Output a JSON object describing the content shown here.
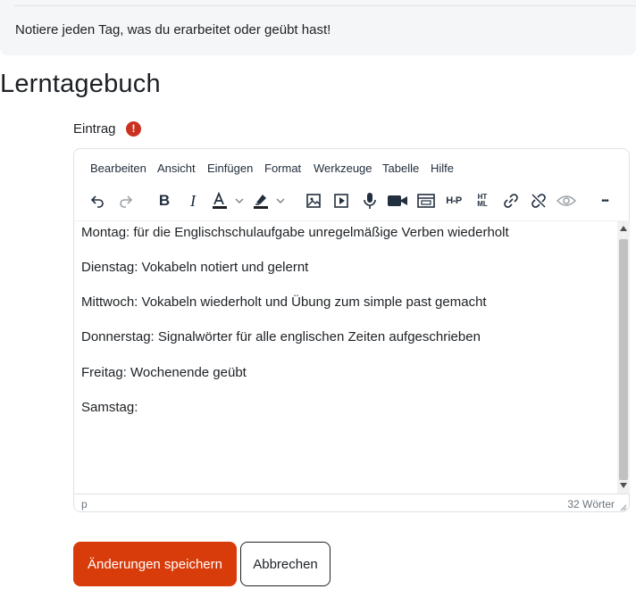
{
  "notice": {
    "text": "Notiere jeden Tag, was du erarbeitet oder geübt hast!"
  },
  "page": {
    "title": "Lerntagebuch"
  },
  "field": {
    "label": "Eintrag",
    "required_icon": "exclamation-circle-icon",
    "required_color": "#ca3120"
  },
  "editor": {
    "menu": [
      "Bearbeiten",
      "Ansicht",
      "Einfügen",
      "Format",
      "Werkzeuge",
      "Tabelle",
      "Hilfe"
    ],
    "toolbar_icons": [
      "undo-icon",
      "redo-icon",
      "bold-icon",
      "italic-icon",
      "text-color-icon",
      "highlight-color-icon",
      "image-icon",
      "media-icon",
      "microphone-icon",
      "video-camera-icon",
      "embed-icon",
      "h5p-icon",
      "html-icon",
      "link-icon",
      "unlink-icon",
      "preview-eye-icon",
      "more-icon"
    ],
    "toolbar_text": {
      "bold": "B",
      "italic": "I",
      "h5p": "H-P",
      "html": "HT ML",
      "more": "•••"
    },
    "paragraphs": [
      "Montag: für die Englischschulaufgabe unregelmäßige Verben wiederholt",
      "Dienstag: Vokabeln notiert und gelernt",
      "Mittwoch: Vokabeln wiederholt und Übung zum simple past gemacht",
      "Donnerstag: Signalwörter für alle englischen Zeiten aufgeschrieben",
      "Freitag: Wochenende geübt",
      "Samstag:"
    ],
    "status_path": "p",
    "word_count": "32 Wörter"
  },
  "buttons": {
    "save": "Änderungen speichern",
    "cancel": "Abbrechen"
  },
  "colors": {
    "primary": "#d93c0b",
    "text": "#1d2125",
    "notice_bg": "#f5f6f7"
  }
}
